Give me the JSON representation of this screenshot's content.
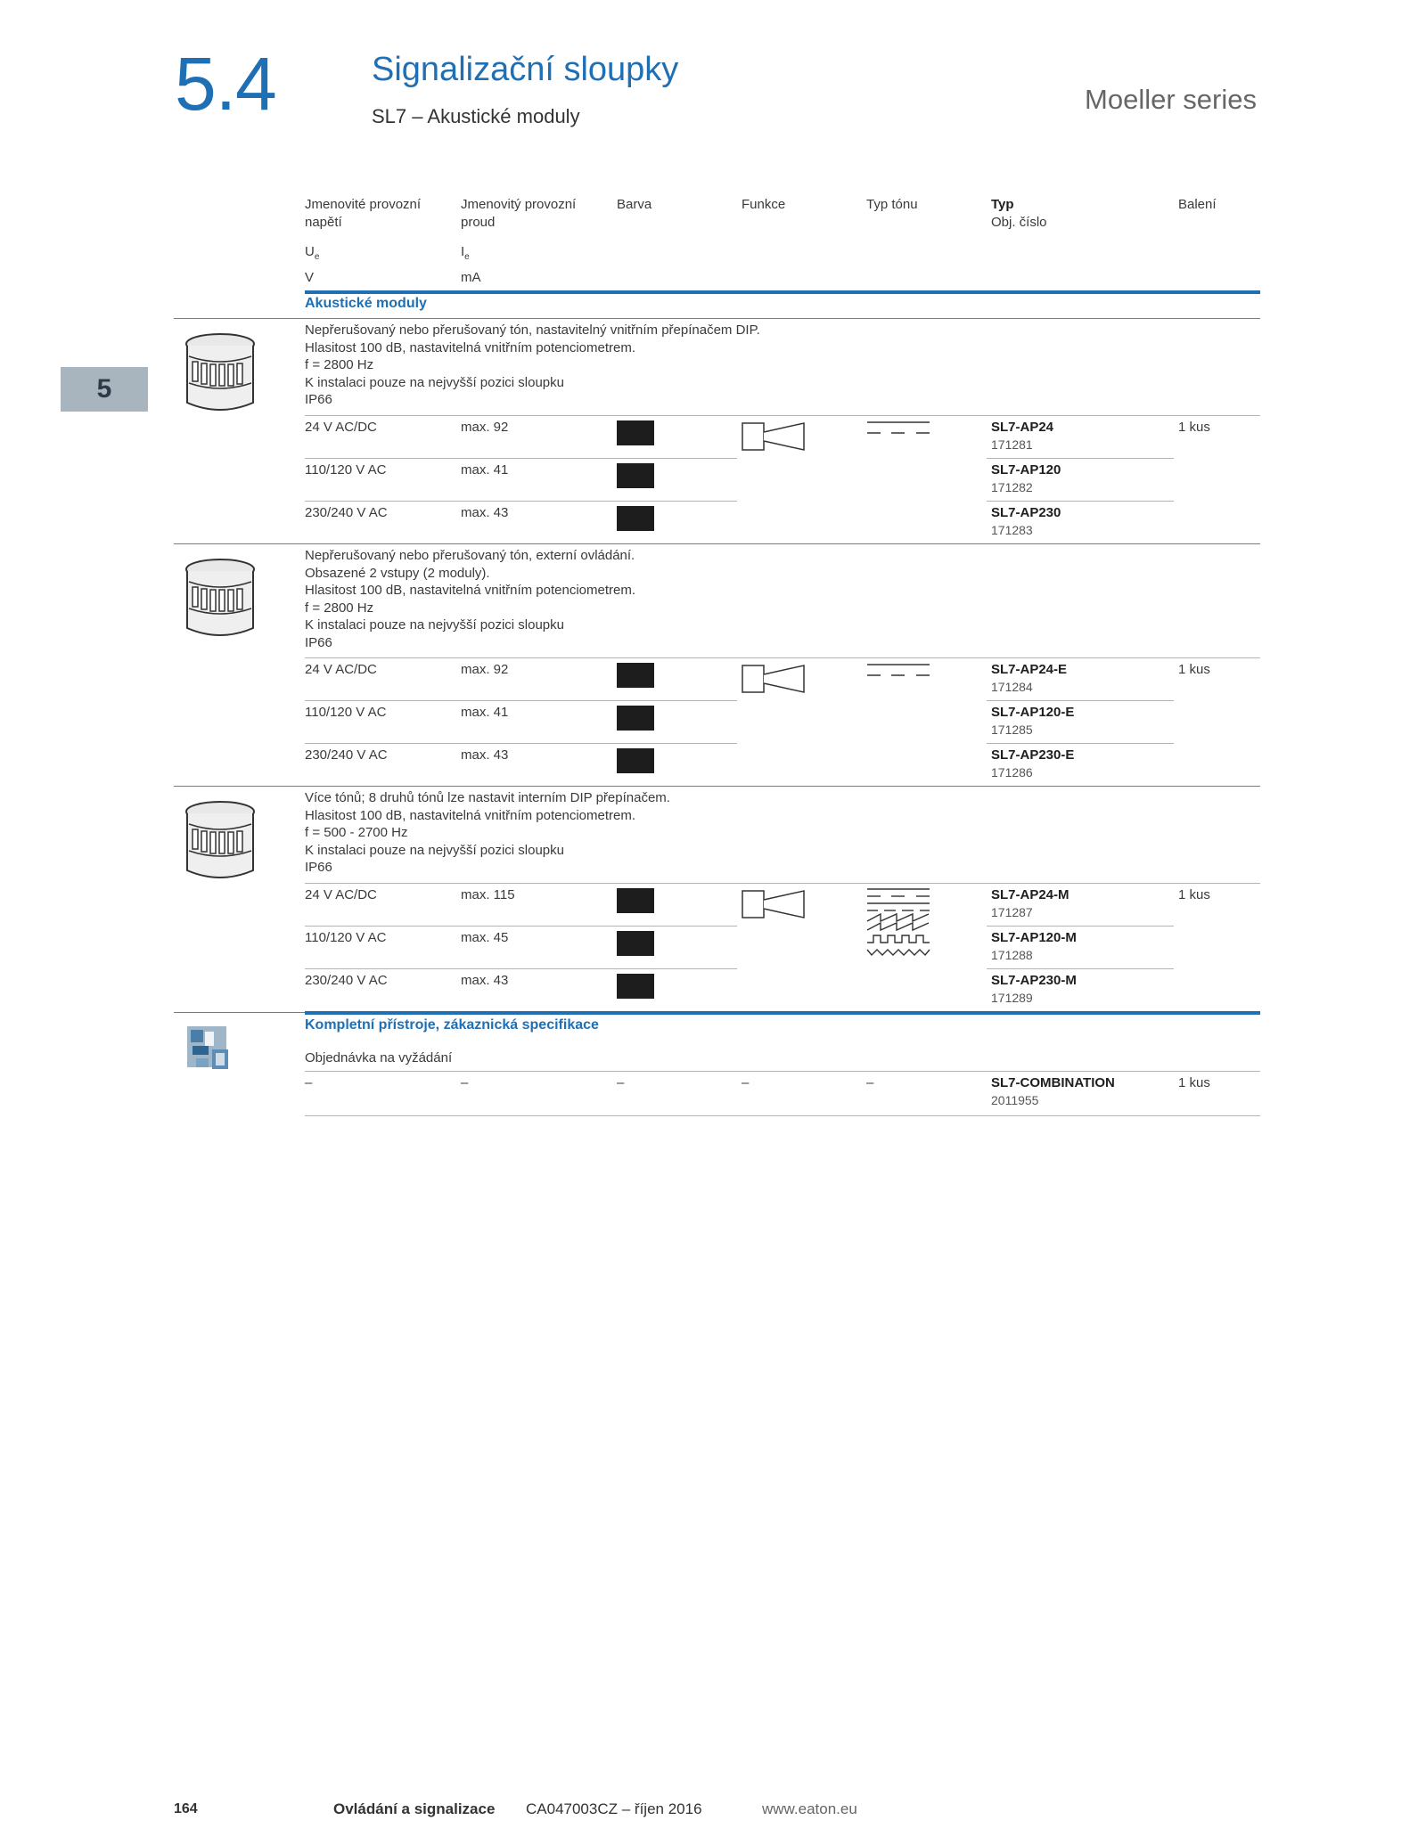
{
  "header": {
    "section_number": "5.4",
    "title": "Signalizační sloupky",
    "subtitle": "SL7 – Akustické moduly",
    "series": "Moeller series",
    "chapter_tab": "5"
  },
  "columns": {
    "voltage_label": "Jmenovité provozní napětí",
    "voltage_symbol": "U",
    "voltage_symbol_sub": "e",
    "voltage_unit": "V",
    "current_label": "Jmenovitý provozní proud",
    "current_symbol": "I",
    "current_symbol_sub": "e",
    "current_unit": "mA",
    "color": "Barva",
    "function": "Funkce",
    "tone_type": "Typ tónu",
    "type": "Typ",
    "order_no": "Obj. číslo",
    "packaging": "Balení"
  },
  "section_acoustic": "Akustické moduly",
  "groups": [
    {
      "description": "Nepřerušovaný nebo přerušovaný tón, nastavitelný vnitřním přepínačem DIP.\nHlasitost 100 dB, nastavitelná vnitřním potenciometrem.\nf = 2800 Hz\nK instalaci pouze na nejvyšší pozici sloupku\nIP66",
      "packaging": "1 kus",
      "rows": [
        {
          "voltage": "24 V AC/DC",
          "current": "max. 92",
          "type": "SL7-AP24",
          "order": "171281"
        },
        {
          "voltage": "110/120 V AC",
          "current": "max. 41",
          "type": "SL7-AP120",
          "order": "171282"
        },
        {
          "voltage": "230/240 V AC",
          "current": "max. 43",
          "type": "SL7-AP230",
          "order": "171283"
        }
      ]
    },
    {
      "description": "Nepřerušovaný nebo přerušovaný tón, externí ovládání.\nObsazené 2 vstupy (2 moduly).\nHlasitost 100 dB, nastavitelná vnitřním potenciometrem.\nf = 2800 Hz\nK instalaci pouze na nejvyšší pozici sloupku\nIP66",
      "packaging": "1 kus",
      "rows": [
        {
          "voltage": "24 V AC/DC",
          "current": "max. 92",
          "type": "SL7-AP24-E",
          "order": "171284"
        },
        {
          "voltage": "110/120 V AC",
          "current": "max. 41",
          "type": "SL7-AP120-E",
          "order": "171285"
        },
        {
          "voltage": "230/240 V AC",
          "current": "max. 43",
          "type": "SL7-AP230-E",
          "order": "171286"
        }
      ]
    },
    {
      "description": "Více tónů; 8 druhů tónů lze nastavit interním DIP přepínačem.\nHlasitost 100 dB, nastavitelná vnitřním potenciometrem.\nf = 500 - 2700 Hz\nK instalaci pouze na nejvyšší pozici sloupku\nIP66",
      "packaging": "1 kus",
      "rows": [
        {
          "voltage": "24 V AC/DC",
          "current": "max. 115",
          "type": "SL7-AP24-M",
          "order": "171287"
        },
        {
          "voltage": "110/120 V AC",
          "current": "max. 45",
          "type": "SL7-AP120-M",
          "order": "171288"
        },
        {
          "voltage": "230/240 V AC",
          "current": "max. 43",
          "type": "SL7-AP230-M",
          "order": "171289"
        }
      ]
    }
  ],
  "section_complete": {
    "title": "Kompletní přístroje, zákaznická specifikace",
    "note": "Objednávka na vyžádání",
    "dash": "–",
    "type": "SL7-COMBINATION",
    "order": "2011955",
    "packaging": "1 kus"
  },
  "footer": {
    "page_number": "164",
    "chapter": "Ovládání a signalizace",
    "catalog": "CA047003CZ – říjen 2016",
    "website": "www.eaton.eu"
  },
  "colors": {
    "accent": "#1f6fb5",
    "swatch": "#1d1d1d",
    "tab": "#a8b4be"
  }
}
